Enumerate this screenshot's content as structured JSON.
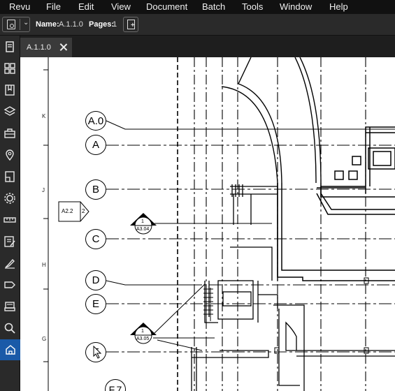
{
  "menu": [
    "Revu",
    "File",
    "Edit",
    "View",
    "Document",
    "Batch",
    "Tools",
    "Window",
    "Help"
  ],
  "toolbar": {
    "name_label": "Name:",
    "name_value": "A.1.1.0",
    "pages_label": "Pages:",
    "pages_value": "1"
  },
  "tools": [
    "file-info-icon",
    "thumbnails-icon",
    "bookmarks-icon",
    "layers-icon",
    "toolchest-icon",
    "places-icon",
    "sheets-icon",
    "properties-icon",
    "measurements-icon",
    "markups-list-icon",
    "signatures-icon",
    "tags-icon",
    "studio-icon",
    "search-icon",
    "links-icon"
  ],
  "tab": {
    "label": "A.1.1.0"
  },
  "ruler_labels": [
    "K",
    "J",
    "H",
    "G"
  ],
  "grid_bubbles": [
    "A.0",
    "A",
    "B",
    "C",
    "D",
    "E",
    "F",
    "F.7"
  ],
  "sheet_tag": {
    "ref": "A2.2",
    "num": "2"
  },
  "section_markers": [
    {
      "num": "1",
      "sheet": "A3.04"
    },
    {
      "num": "1",
      "sheet": "A3.05"
    }
  ]
}
